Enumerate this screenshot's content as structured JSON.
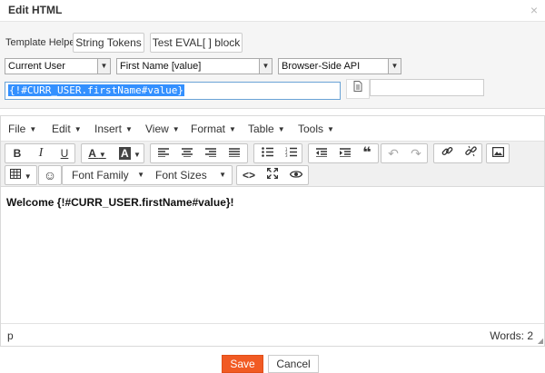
{
  "dialog": {
    "title": "Edit HTML",
    "close_glyph": "×"
  },
  "helper": {
    "label": "Template Helper",
    "string_tokens_label": "String Tokens",
    "test_eval_label": "Test EVAL[ ] block",
    "selects": [
      "Current User",
      "First Name [value]",
      "Browser-Side API"
    ],
    "token_value": "{!#CURR_USER.firstName#value}",
    "side_input_value": ""
  },
  "editor": {
    "menus": [
      "File",
      "Edit",
      "Insert",
      "View",
      "Format",
      "Table",
      "Tools"
    ],
    "font_family_label": "Font Family",
    "font_sizes_label": "Font Sizes",
    "content_text": "Welcome {!#CURR_USER.firstName#value}!",
    "status_path": "p",
    "word_count": "Words: 2"
  },
  "footer": {
    "save_label": "Save",
    "cancel_label": "Cancel"
  },
  "colors": {
    "accent": "#f15a23",
    "selection": "#3390ff",
    "input_border": "#6aa3d6"
  },
  "icons": [
    "bold-icon",
    "italic-icon",
    "underline-icon",
    "text-color-icon",
    "background-color-icon",
    "align-left-icon",
    "align-center-icon",
    "align-right-icon",
    "align-justify-icon",
    "bullet-list-icon",
    "numbered-list-icon",
    "outdent-icon",
    "indent-icon",
    "blockquote-icon",
    "undo-icon",
    "redo-icon",
    "link-icon",
    "unlink-icon",
    "image-icon",
    "table-icon",
    "emoticon-icon",
    "code-icon",
    "fullscreen-icon",
    "preview-icon",
    "document-icon",
    "close-icon"
  ]
}
